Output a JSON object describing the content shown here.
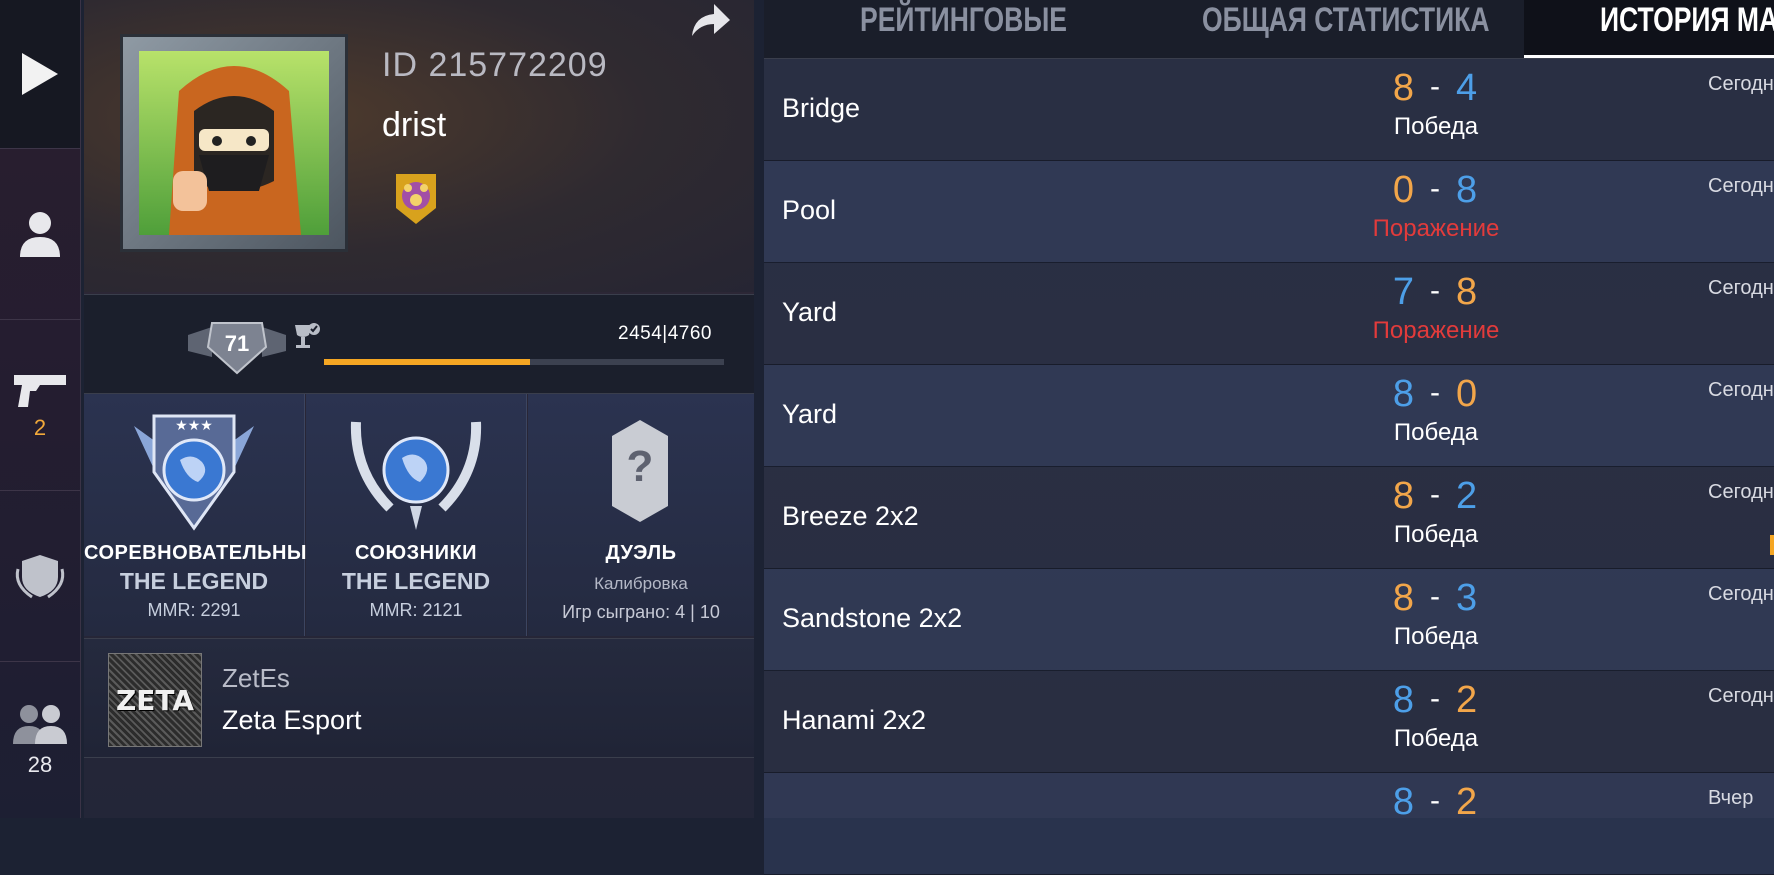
{
  "rail": {
    "items": [
      {
        "name": "play",
        "count": ""
      },
      {
        "name": "profile",
        "count": ""
      },
      {
        "name": "weapons",
        "count": "2"
      },
      {
        "name": "clan",
        "count": ""
      },
      {
        "name": "friends",
        "count": "28"
      }
    ]
  },
  "profile": {
    "id_text": "ID 215772209",
    "nickname": "drist",
    "level": "71",
    "xp_text": "2454|4760",
    "xp_fraction": 0.515,
    "ranks": [
      {
        "mode": "СОРЕВНОВАТЕЛЬНЫЙ",
        "rank": "THE LEGEND",
        "mmr": "MMR: 2291"
      },
      {
        "mode": "СОЮЗНИКИ",
        "rank": "THE LEGEND",
        "mmr": "MMR: 2121"
      }
    ],
    "duel": {
      "mode": "ДУЭЛЬ",
      "status": "Калибровка",
      "games": "Игр сыграно: 4 | 10",
      "icon_glyph": "?"
    },
    "clan": {
      "logo_text": "ZETA",
      "tag": "ZetEs",
      "name": "Zeta Esport"
    }
  },
  "tabs": [
    {
      "label": "РЕЙТИНГОВЫЕ",
      "active": false
    },
    {
      "label": "ОБЩАЯ СТАТИСТИКА",
      "active": false
    },
    {
      "label": "ИСТОРИЯ МАТ",
      "active": true
    }
  ],
  "matches": [
    {
      "map": "Bridge",
      "left": "8",
      "right": "4",
      "left_color": "orange",
      "right_color": "blue",
      "result": "Победа",
      "win": true,
      "when": "Сегодн"
    },
    {
      "map": "Pool",
      "left": "0",
      "right": "8",
      "left_color": "orange",
      "right_color": "blue",
      "result": "Поражение",
      "win": false,
      "when": "Сегодн"
    },
    {
      "map": "Yard",
      "left": "7",
      "right": "8",
      "left_color": "blue",
      "right_color": "orange",
      "result": "Поражение",
      "win": false,
      "when": "Сегодн"
    },
    {
      "map": "Yard",
      "left": "8",
      "right": "0",
      "left_color": "blue",
      "right_color": "orange",
      "result": "Победа",
      "win": true,
      "when": "Сегодн"
    },
    {
      "map": "Breeze 2x2",
      "left": "8",
      "right": "2",
      "left_color": "orange",
      "right_color": "blue",
      "result": "Победа",
      "win": true,
      "when": "Сегодн"
    },
    {
      "map": "Sandstone 2x2",
      "left": "8",
      "right": "3",
      "left_color": "orange",
      "right_color": "blue",
      "result": "Победа",
      "win": true,
      "when": "Сегодн"
    },
    {
      "map": "Hanami 2x2",
      "left": "8",
      "right": "2",
      "left_color": "blue",
      "right_color": "orange",
      "result": "Победа",
      "win": true,
      "when": "Сегодн"
    },
    {
      "map": "",
      "left": "8",
      "right": "2",
      "left_color": "blue",
      "right_color": "orange",
      "result": "",
      "win": true,
      "when": "Вчер"
    }
  ],
  "score_separator": "-",
  "colors": {
    "accent": "#f5a623",
    "win": "#ffffff",
    "loss": "#e23b3b",
    "team_orange": "#f2a64a",
    "team_blue": "#4d9fe8"
  }
}
